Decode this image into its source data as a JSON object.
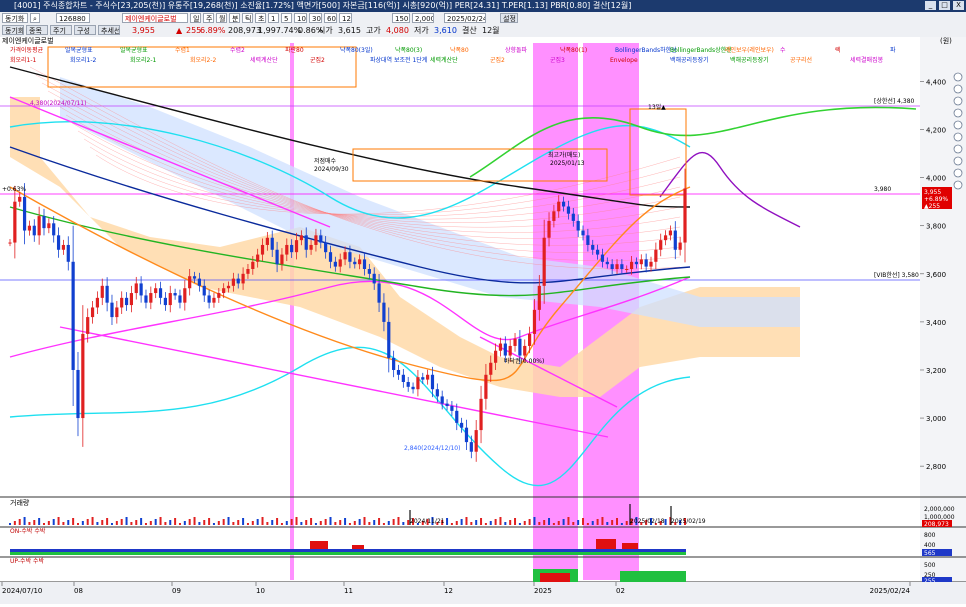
{
  "window": {
    "title": "[4001] 주식종합차트 - 주식수[23,205(천)] 유통주[19,268(천)] 소진율[1.72%] 액면가[500] 자본금[116(억)] 시총[920(억)] PER[24.31] T.PER[1.13] PBR[0.80] 결산[12월]",
    "controls": [
      "_",
      "□",
      "X"
    ]
  },
  "toolbar": {
    "code": "126880",
    "mode": "동기화",
    "name": "제이엔케이글로벌",
    "period_tabs": [
      "일",
      "주",
      "월",
      "분",
      "틱",
      "초",
      "1",
      "5",
      "10",
      "30",
      "60",
      "120"
    ],
    "count": "150",
    "total": "2,000",
    "date": "2025/02/24",
    "apply_label": "설정",
    "price": "3,955",
    "change": "255",
    "change_arrow": "▲",
    "pct": "6.89%",
    "volume": "208,973",
    "volume_ratio": "1,997.74%",
    "turnover": "0.86%",
    "open_label": "시가",
    "open": "3,615",
    "high_label": "고가",
    "high": "4,080",
    "low_label": "저가",
    "low": "3,610",
    "close_label": "결산",
    "close_month": "12월"
  },
  "toolbar2": {
    "items": [
      "동기화",
      "종목",
      "주기",
      "구성",
      "추세선"
    ]
  },
  "chart": {
    "title": "제이엔케이글로벌",
    "unit_label": "(원)",
    "legend_row1": [
      "가격이동평균",
      "일목균형표",
      "일목균형표",
      "수렴1",
      "수렴2",
      "파란80",
      "낙폭80(3일)",
      "낙폭80(3)",
      "낙폭80",
      "상향돌파",
      "낙폭80(1)",
      "BollingerBands하한선",
      "BollingerBands상한선",
      "레인보우(레인보우)",
      "수",
      "렉",
      "파"
    ],
    "legend_row2": [
      "회오리1-1",
      "회오리1-2",
      "회오리2-1",
      "회오리2-2",
      "세력계산단",
      "군집2",
      "파상대역 보조전 1단계",
      "세력계산단",
      "군집2",
      "군집3",
      "Envelope",
      "백해공리등장기",
      "백해공리등장기",
      "공구리선",
      "세력결매집봉"
    ],
    "y_ticks": [
      "4,400",
      "4,200",
      "4,000",
      "3,800",
      "3,600",
      "3,400",
      "3,200",
      "3,000",
      "2,800"
    ],
    "x_ticks": [
      "2024/07/10",
      "08",
      "09",
      "10",
      "11",
      "12",
      "2025",
      "02",
      "2025/02/24"
    ],
    "annotations": {
      "prev_high": "4,380(2024/07/11)",
      "pct_left": "+0.63%",
      "upper_limit": "[상한선] 4,380",
      "mid_price": "3,980",
      "vib": "[VIB한선] 3,580",
      "low_mark": "2,840(2024/12/10)",
      "trough_label": "바닥권(0.00%)",
      "peak_label": "최고가(매도)",
      "peak_date": "2025/01/13",
      "top_pivot": "13일▲",
      "current_price": "3,955",
      "current_pct": "+6.89%",
      "current_change": "▲255",
      "early_label": "저점매수",
      "early_label2": "2024/09/30"
    },
    "sub_panels": [
      {
        "name": "거래량",
        "ticks": [
          "2,000,000",
          "1,000,000"
        ],
        "badge": "208,973",
        "date_label1": "2024/11/21",
        "date_label2": "2025/02/18",
        "date_label3": "2025/02/19"
      },
      {
        "name": "ON-수박 수박",
        "ticks": [
          "800",
          "400"
        ],
        "badge": "565"
      },
      {
        "name": "UP-수박 수박",
        "ticks": [
          "500",
          "250"
        ],
        "badge": "255"
      }
    ]
  },
  "chart_data": {
    "type": "candlestick",
    "title": "제이엔케이글로벌",
    "xlabel": "",
    "ylabel": "",
    "ylim": [
      2680,
      4560
    ],
    "x_start": "2024/07/10",
    "x_end": "2025/02/24",
    "month_ticks": [
      "2024/07/10",
      "08",
      "09",
      "10",
      "11",
      "12",
      "2025",
      "02"
    ],
    "prices_close": [
      3730,
      3900,
      3920,
      3780,
      3800,
      3760,
      3840,
      3790,
      3810,
      3760,
      3700,
      3720,
      3650,
      3200,
      3000,
      3350,
      3420,
      3460,
      3500,
      3550,
      3480,
      3420,
      3460,
      3500,
      3470,
      3520,
      3560,
      3510,
      3480,
      3520,
      3540,
      3500,
      3470,
      3520,
      3510,
      3480,
      3540,
      3590,
      3580,
      3550,
      3510,
      3480,
      3500,
      3520,
      3540,
      3550,
      3580,
      3560,
      3600,
      3620,
      3650,
      3680,
      3720,
      3750,
      3700,
      3640,
      3680,
      3720,
      3690,
      3740,
      3760,
      3700,
      3720,
      3760,
      3730,
      3690,
      3650,
      3630,
      3660,
      3690,
      3650,
      3640,
      3660,
      3620,
      3600,
      3560,
      3480,
      3400,
      3250,
      3200,
      3180,
      3150,
      3130,
      3120,
      3170,
      3160,
      3180,
      3120,
      3090,
      3060,
      3050,
      3030,
      2980,
      2960,
      2900,
      2860,
      2950,
      3080,
      3180,
      3230,
      3280,
      3310,
      3260,
      3300,
      3330,
      3260,
      3300,
      3350,
      3450,
      3550,
      3750,
      3820,
      3860,
      3900,
      3880,
      3850,
      3820,
      3780,
      3760,
      3720,
      3700,
      3680,
      3650,
      3640,
      3620,
      3640,
      3620,
      3620,
      3650,
      3640,
      3660,
      3630,
      3650,
      3700,
      3740,
      3760,
      3780,
      3700,
      3730,
      3955
    ],
    "candles_note": "daily OHLC approximated from close series",
    "series": [
      {
        "name": "BollingerBands상한선",
        "color": "#00d8ff"
      },
      {
        "name": "BollingerBands하한선",
        "color": "#00d8ff"
      },
      {
        "name": "Envelope",
        "color": "#e000e0"
      },
      {
        "name": "일목균형표",
        "color": "#ff9a3c"
      },
      {
        "name": "가격이동평균",
        "color": "#0a2a9c"
      }
    ],
    "volume_peaks": [
      {
        "date": "2024/11/21",
        "value": 1500000
      },
      {
        "date": "2025/02/18",
        "value": 2100000
      },
      {
        "date": "2025/02/19",
        "value": 1900000
      }
    ],
    "latest": {
      "close": 3955,
      "change": 255,
      "pct": 6.89,
      "volume": 208973
    }
  },
  "colors": {
    "up": "#e02020",
    "down": "#1040d0",
    "cloud_orange": "#ffd9a8",
    "cloud_blue": "#cfe0ff",
    "magenta": "#ff33ff",
    "pink_band": "#ff7dff",
    "cyan": "#1fe0f0",
    "green": "#22b422",
    "black": "#111111"
  }
}
